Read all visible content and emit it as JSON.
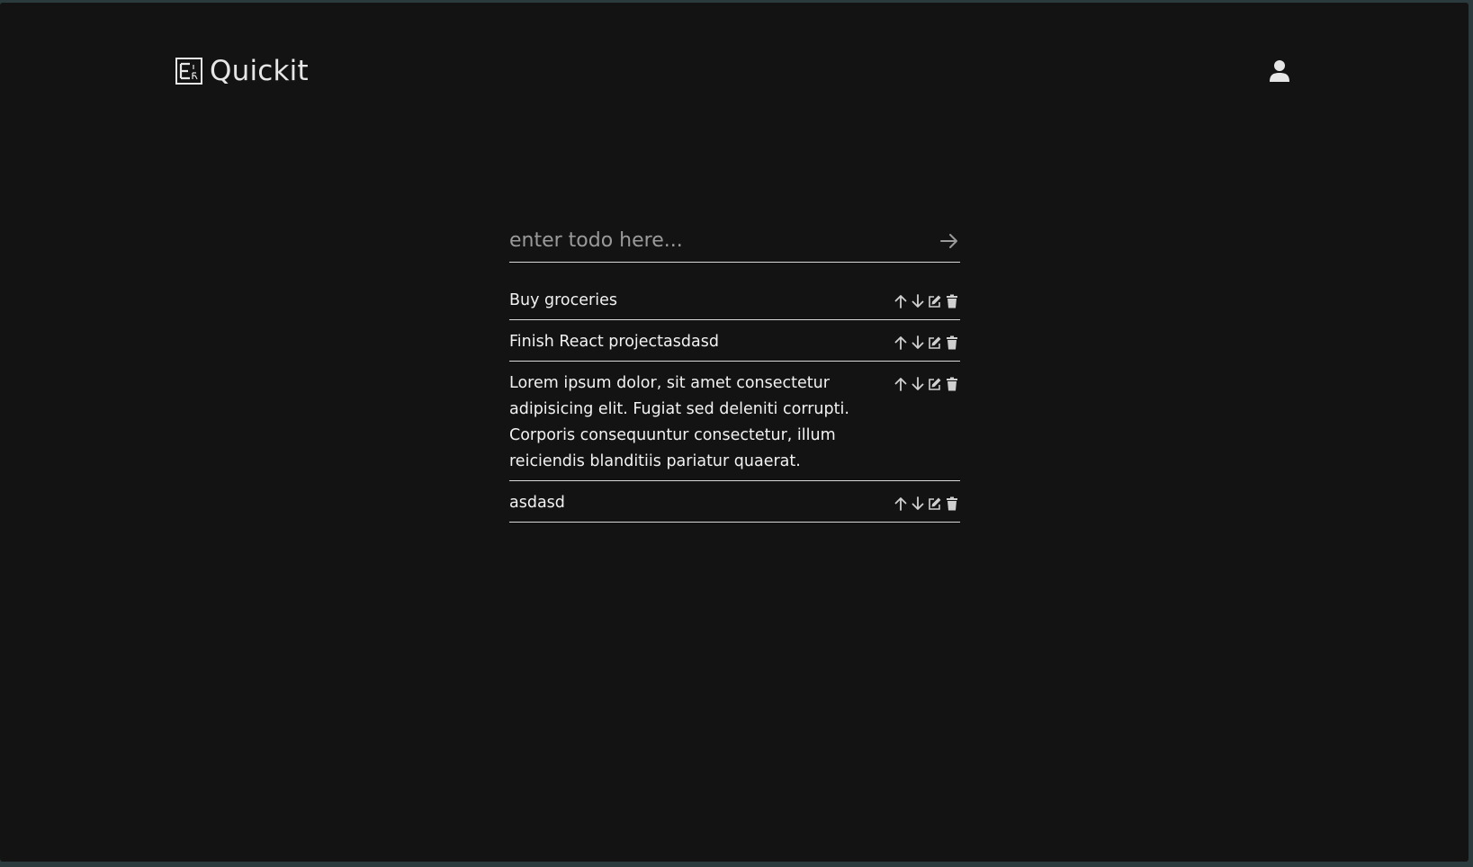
{
  "app": {
    "name": "Quickit"
  },
  "header": {
    "profile_icon": "user-icon",
    "logo_icon": "logo-icon"
  },
  "todo_input": {
    "placeholder": "enter todo here...",
    "value": "",
    "submit_icon": "arrow-right-icon"
  },
  "todos": [
    {
      "text": "Buy groceries"
    },
    {
      "text": "Finish React projectasdasd"
    },
    {
      "text": "Lorem ipsum dolor, sit amet consectetur adipisicing elit. Fugiat sed deleniti corrupti. Corporis consequuntur consectetur, illum reiciendis blanditiis pariatur quaerat."
    },
    {
      "text": "asdasd"
    }
  ],
  "item_actions": [
    "arrow-up-icon",
    "arrow-down-icon",
    "edit-icon",
    "trash-icon"
  ],
  "colors": {
    "background": "#131313",
    "text": "#f2f2f2",
    "placeholder": "#9a9a9a",
    "divider": "#d9d9d9"
  }
}
